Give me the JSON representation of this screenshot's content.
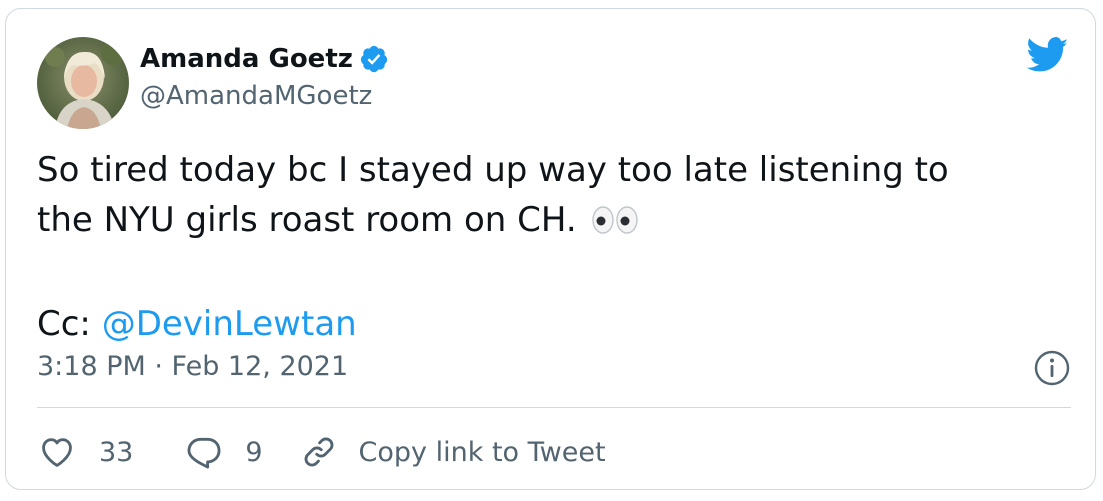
{
  "author": {
    "display_name": "Amanda Goetz",
    "handle": "@AmandaMGoetz",
    "verified": true
  },
  "tweet": {
    "text_line1": "So tired today bc I stayed up way too late listening to",
    "text_line2": "the NYU girls roast room on CH. ",
    "emoji": "👀",
    "cc_prefix": "Cc: ",
    "mention": "@DevinLewtan",
    "timestamp": "3:18 PM · Feb 12, 2021"
  },
  "actions": {
    "like_count": "33",
    "reply_count": "9",
    "copy_label": "Copy link to Tweet"
  },
  "icons": {
    "brand": "twitter-bird-icon",
    "verified": "verified-badge-icon",
    "info": "info-icon",
    "like": "heart-icon",
    "reply": "reply-bubble-icon",
    "copy": "link-icon"
  },
  "colors": {
    "accent": "#1d9bf0",
    "text": "#0f1419",
    "muted": "#536471",
    "border": "#cfd9de"
  }
}
